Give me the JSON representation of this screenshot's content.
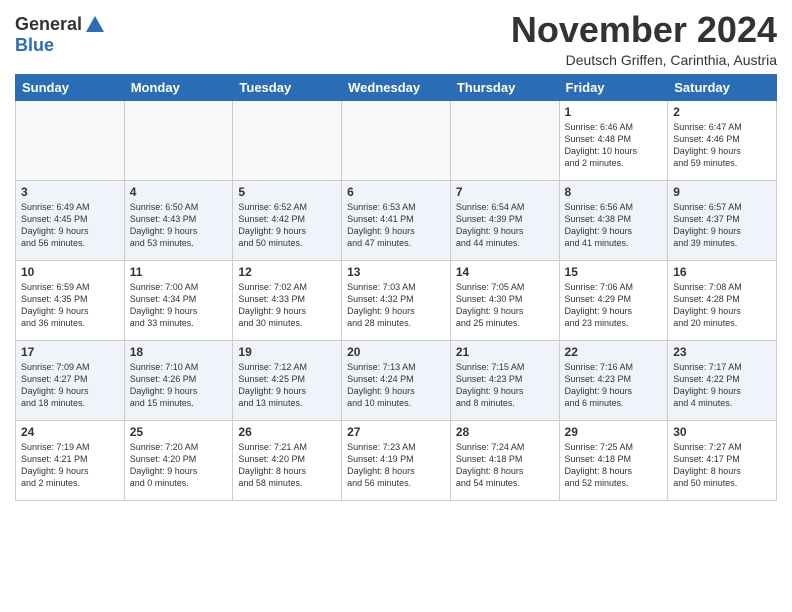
{
  "header": {
    "logo_line1": "General",
    "logo_line2": "Blue",
    "month_title": "November 2024",
    "location": "Deutsch Griffen, Carinthia, Austria"
  },
  "weekdays": [
    "Sunday",
    "Monday",
    "Tuesday",
    "Wednesday",
    "Thursday",
    "Friday",
    "Saturday"
  ],
  "weeks": [
    [
      {
        "day": "",
        "info": ""
      },
      {
        "day": "",
        "info": ""
      },
      {
        "day": "",
        "info": ""
      },
      {
        "day": "",
        "info": ""
      },
      {
        "day": "",
        "info": ""
      },
      {
        "day": "1",
        "info": "Sunrise: 6:46 AM\nSunset: 4:48 PM\nDaylight: 10 hours\nand 2 minutes."
      },
      {
        "day": "2",
        "info": "Sunrise: 6:47 AM\nSunset: 4:46 PM\nDaylight: 9 hours\nand 59 minutes."
      }
    ],
    [
      {
        "day": "3",
        "info": "Sunrise: 6:49 AM\nSunset: 4:45 PM\nDaylight: 9 hours\nand 56 minutes."
      },
      {
        "day": "4",
        "info": "Sunrise: 6:50 AM\nSunset: 4:43 PM\nDaylight: 9 hours\nand 53 minutes."
      },
      {
        "day": "5",
        "info": "Sunrise: 6:52 AM\nSunset: 4:42 PM\nDaylight: 9 hours\nand 50 minutes."
      },
      {
        "day": "6",
        "info": "Sunrise: 6:53 AM\nSunset: 4:41 PM\nDaylight: 9 hours\nand 47 minutes."
      },
      {
        "day": "7",
        "info": "Sunrise: 6:54 AM\nSunset: 4:39 PM\nDaylight: 9 hours\nand 44 minutes."
      },
      {
        "day": "8",
        "info": "Sunrise: 6:56 AM\nSunset: 4:38 PM\nDaylight: 9 hours\nand 41 minutes."
      },
      {
        "day": "9",
        "info": "Sunrise: 6:57 AM\nSunset: 4:37 PM\nDaylight: 9 hours\nand 39 minutes."
      }
    ],
    [
      {
        "day": "10",
        "info": "Sunrise: 6:59 AM\nSunset: 4:35 PM\nDaylight: 9 hours\nand 36 minutes."
      },
      {
        "day": "11",
        "info": "Sunrise: 7:00 AM\nSunset: 4:34 PM\nDaylight: 9 hours\nand 33 minutes."
      },
      {
        "day": "12",
        "info": "Sunrise: 7:02 AM\nSunset: 4:33 PM\nDaylight: 9 hours\nand 30 minutes."
      },
      {
        "day": "13",
        "info": "Sunrise: 7:03 AM\nSunset: 4:32 PM\nDaylight: 9 hours\nand 28 minutes."
      },
      {
        "day": "14",
        "info": "Sunrise: 7:05 AM\nSunset: 4:30 PM\nDaylight: 9 hours\nand 25 minutes."
      },
      {
        "day": "15",
        "info": "Sunrise: 7:06 AM\nSunset: 4:29 PM\nDaylight: 9 hours\nand 23 minutes."
      },
      {
        "day": "16",
        "info": "Sunrise: 7:08 AM\nSunset: 4:28 PM\nDaylight: 9 hours\nand 20 minutes."
      }
    ],
    [
      {
        "day": "17",
        "info": "Sunrise: 7:09 AM\nSunset: 4:27 PM\nDaylight: 9 hours\nand 18 minutes."
      },
      {
        "day": "18",
        "info": "Sunrise: 7:10 AM\nSunset: 4:26 PM\nDaylight: 9 hours\nand 15 minutes."
      },
      {
        "day": "19",
        "info": "Sunrise: 7:12 AM\nSunset: 4:25 PM\nDaylight: 9 hours\nand 13 minutes."
      },
      {
        "day": "20",
        "info": "Sunrise: 7:13 AM\nSunset: 4:24 PM\nDaylight: 9 hours\nand 10 minutes."
      },
      {
        "day": "21",
        "info": "Sunrise: 7:15 AM\nSunset: 4:23 PM\nDaylight: 9 hours\nand 8 minutes."
      },
      {
        "day": "22",
        "info": "Sunrise: 7:16 AM\nSunset: 4:23 PM\nDaylight: 9 hours\nand 6 minutes."
      },
      {
        "day": "23",
        "info": "Sunrise: 7:17 AM\nSunset: 4:22 PM\nDaylight: 9 hours\nand 4 minutes."
      }
    ],
    [
      {
        "day": "24",
        "info": "Sunrise: 7:19 AM\nSunset: 4:21 PM\nDaylight: 9 hours\nand 2 minutes."
      },
      {
        "day": "25",
        "info": "Sunrise: 7:20 AM\nSunset: 4:20 PM\nDaylight: 9 hours\nand 0 minutes."
      },
      {
        "day": "26",
        "info": "Sunrise: 7:21 AM\nSunset: 4:20 PM\nDaylight: 8 hours\nand 58 minutes."
      },
      {
        "day": "27",
        "info": "Sunrise: 7:23 AM\nSunset: 4:19 PM\nDaylight: 8 hours\nand 56 minutes."
      },
      {
        "day": "28",
        "info": "Sunrise: 7:24 AM\nSunset: 4:18 PM\nDaylight: 8 hours\nand 54 minutes."
      },
      {
        "day": "29",
        "info": "Sunrise: 7:25 AM\nSunset: 4:18 PM\nDaylight: 8 hours\nand 52 minutes."
      },
      {
        "day": "30",
        "info": "Sunrise: 7:27 AM\nSunset: 4:17 PM\nDaylight: 8 hours\nand 50 minutes."
      }
    ]
  ]
}
